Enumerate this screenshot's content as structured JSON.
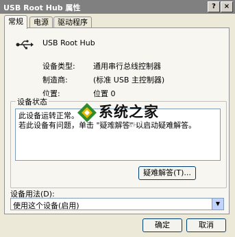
{
  "window": {
    "title": "USB Root Hub 属性",
    "help_button": "?",
    "close_button": "×"
  },
  "tabs": [
    {
      "label": "常规",
      "active": true
    },
    {
      "label": "电源",
      "active": false
    },
    {
      "label": "驱动程序",
      "active": false
    }
  ],
  "device": {
    "icon": "usb-icon",
    "name": "USB Root Hub",
    "properties": [
      {
        "label": "设备类型:",
        "value": "通用串行总线控制器"
      },
      {
        "label": "制造商:",
        "value": "(标准 USB 主控制器)"
      },
      {
        "label": "位置:",
        "value": "位置 0"
      }
    ]
  },
  "status": {
    "title": "设备状态",
    "lines": [
      "此设备运转正常。",
      "若此设备有问题，单击 \"疑难解答\" 以启动疑难解答。"
    ],
    "troubleshoot_button": "疑难解答(T)..."
  },
  "usage": {
    "label": "设备用法(D):",
    "selected": "使用这个设备(启用)"
  },
  "footer": {
    "ok": "确定",
    "cancel": "取消"
  },
  "watermark": {
    "text": "系统之家",
    "sub": "XITONGZHIJIA"
  },
  "colors": {
    "titlebar": "#808080",
    "dialog_bg": "#ece9d8",
    "panel_bg": "#f7f6f0",
    "button_border": "#003c74"
  }
}
